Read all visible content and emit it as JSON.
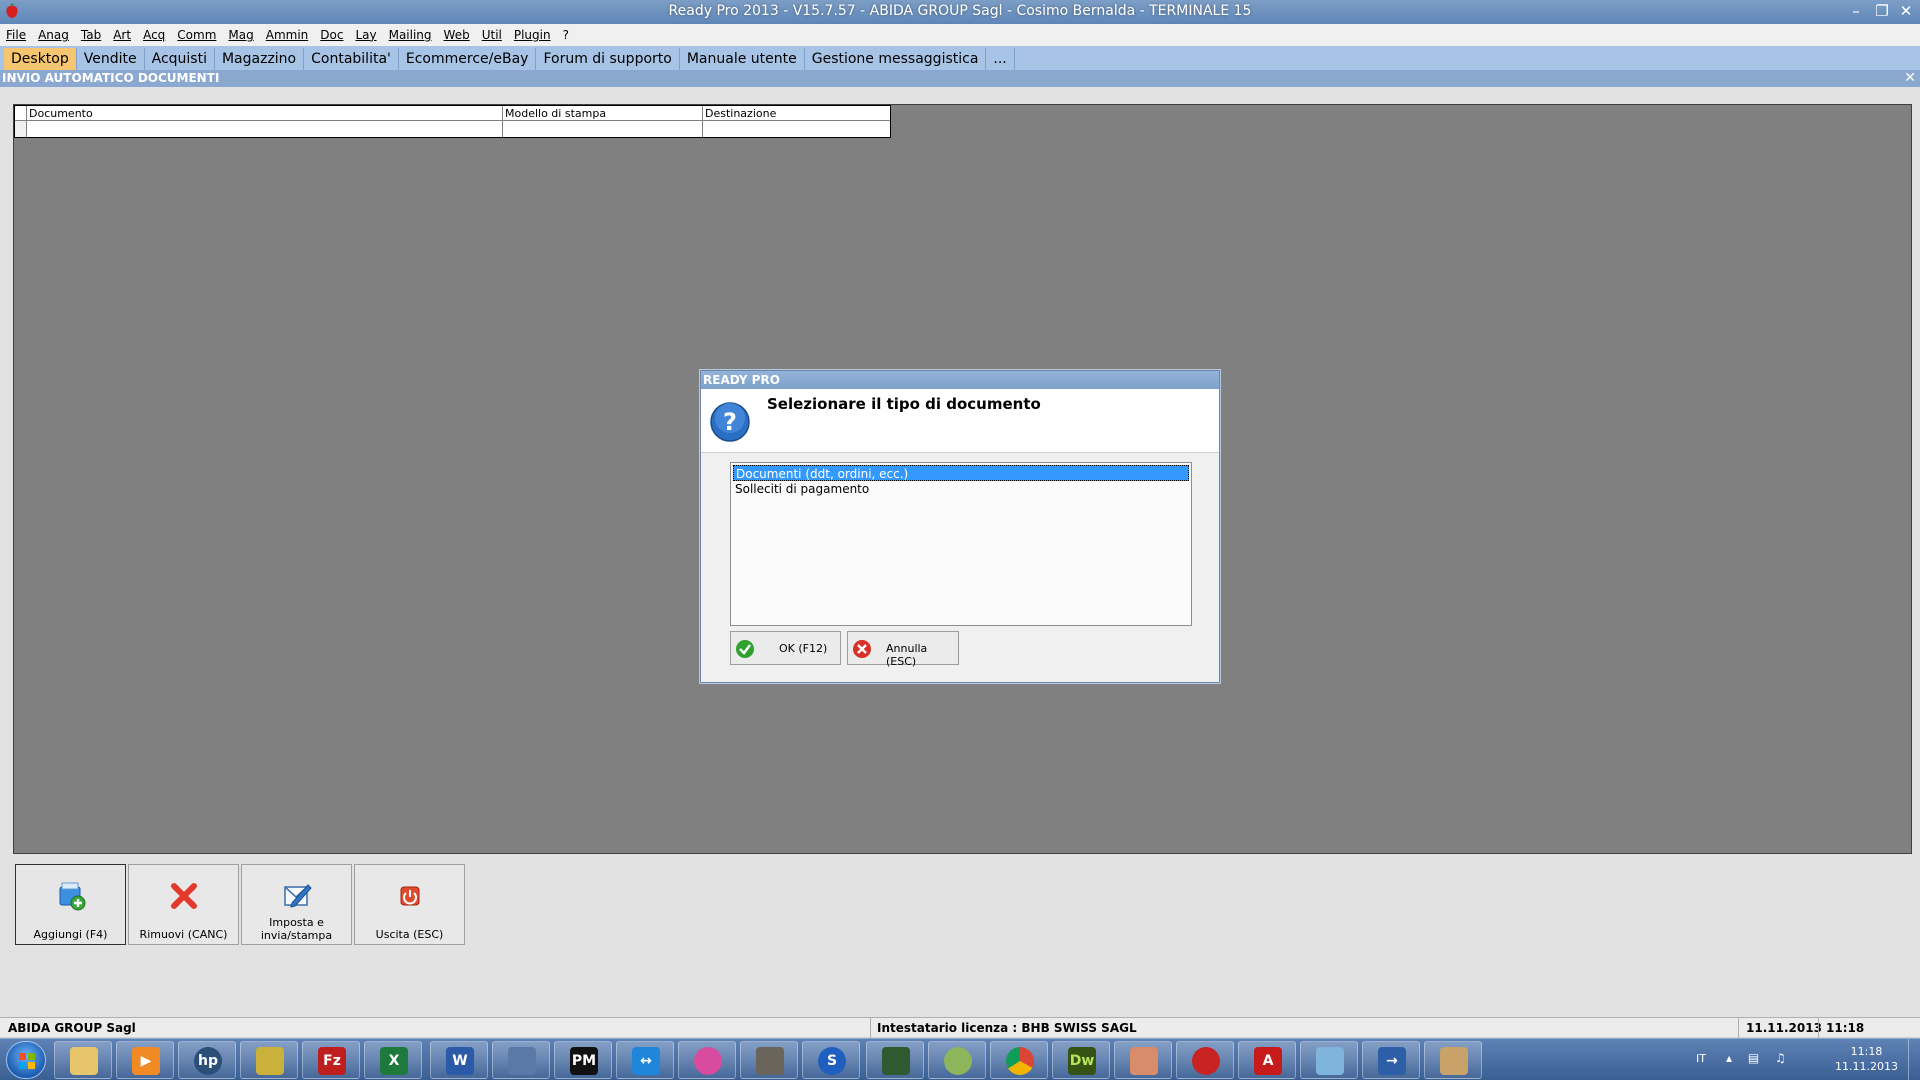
{
  "window": {
    "title": "Ready Pro 2013 - V15.7.57 - ABIDA GROUP Sagl - Cosimo Bernalda - TERMINALE 15"
  },
  "menu": [
    "File",
    "Anag",
    "Tab",
    "Art",
    "Acq",
    "Comm",
    "Mag",
    "Ammin",
    "Doc",
    "Lay",
    "Mailing",
    "Web",
    "Util",
    "Plugin",
    "?"
  ],
  "tabs": [
    "Desktop",
    "Vendite",
    "Acquisti",
    "Magazzino",
    "Contabilita'",
    "Ecommerce/eBay",
    "Forum di supporto",
    "Manuale utente",
    "Gestione messaggistica",
    "..."
  ],
  "module": {
    "title": "INVIO AUTOMATICO DOCUMENTI",
    "columns": [
      "Documento",
      "Modello di stampa",
      "Destinazione"
    ]
  },
  "bottom_buttons": [
    {
      "label": "Aggiungi (F4)",
      "icon": "add-document-icon"
    },
    {
      "label": "Rimuovi (CANC)",
      "icon": "remove-x-icon"
    },
    {
      "label": "Imposta e invia/stampa",
      "icon": "edit-send-icon"
    },
    {
      "label": "Uscita (ESC)",
      "icon": "power-exit-icon"
    }
  ],
  "dialog": {
    "title": "READY PRO",
    "question": "Selezionare il tipo di documento",
    "options": [
      "Documenti (ddt, ordini, ecc.)",
      "Solleciti di pagamento"
    ],
    "selected_index": 0,
    "ok_label": "OK (F12)",
    "cancel_label": "Annulla (ESC)"
  },
  "status": {
    "company": "ABIDA GROUP Sagl",
    "license": "Intestatario licenza : BHB SWISS SAGL",
    "date": "11.11.2013",
    "time": "11:18"
  },
  "taskbar": {
    "apps": [
      "explorer",
      "media-player",
      "hp",
      "file-manager",
      "filezilla",
      "excel",
      "word",
      "network",
      "pm",
      "teamviewer",
      "picasa",
      "gimp",
      "skype",
      "terminal",
      "sync",
      "chrome",
      "dreamweaver",
      "mail",
      "ready-pro",
      "acrobat",
      "notepad",
      "pdf-convert",
      "paint"
    ],
    "language": "IT",
    "clock_time": "11:18",
    "clock_date": "11.11.2013"
  },
  "colors": {
    "active_tab": "#f6c56f",
    "tabbar": "#a7c4e6",
    "selection": "#3399ff",
    "work_gray": "#808080"
  }
}
